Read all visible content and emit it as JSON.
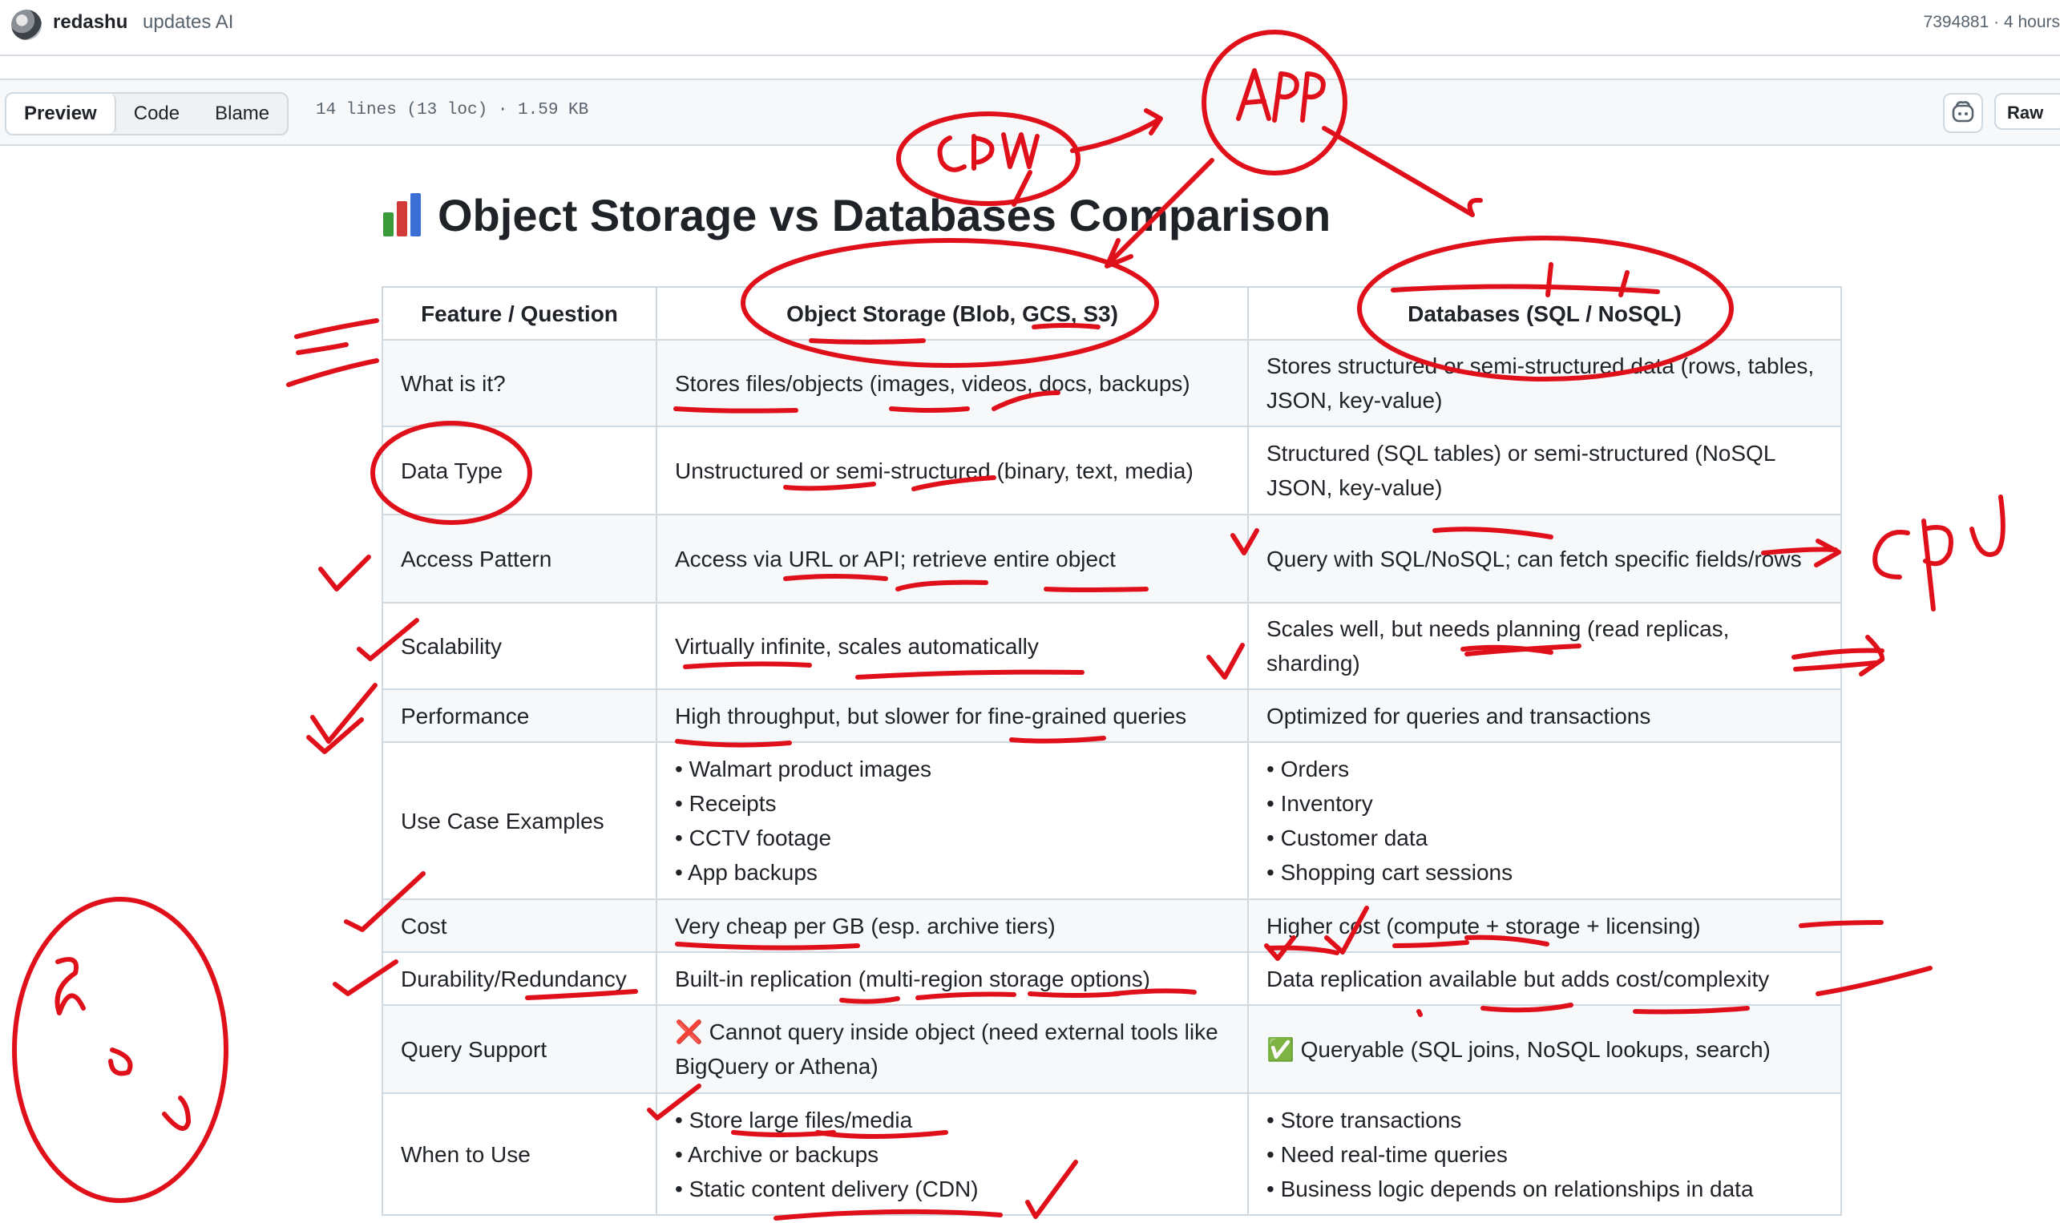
{
  "commit": {
    "author": "redashu",
    "message": "updates AI",
    "meta": "7394881 · 4 hours"
  },
  "file_header": {
    "tabs": [
      "Preview",
      "Code",
      "Blame"
    ],
    "active_tab": "Preview",
    "info": "14 lines (13 loc) · 1.59 KB",
    "raw_label": "Raw"
  },
  "document": {
    "title": "Object Storage vs Databases Comparison",
    "title_icon": "bar-chart-emoji",
    "headers": [
      "Feature / Question",
      "Object Storage (Blob, GCS, S3)",
      "Databases (SQL / NoSQL)"
    ],
    "rows": [
      {
        "feature": "What is it?",
        "object": "Stores files/objects (images, videos, docs, backups)",
        "db": "Stores structured or semi-structured data (rows, tables, JSON, key-value)"
      },
      {
        "feature": "Data Type",
        "object": "Unstructured or semi-structured (binary, text, media)",
        "db": "Structured (SQL tables) or semi-structured (NoSQL JSON, key-value)"
      },
      {
        "feature": "Access Pattern",
        "object": "Access via URL or API; retrieve entire object",
        "db": "Query with SQL/NoSQL; can fetch specific fields/rows"
      },
      {
        "feature": "Scalability",
        "object": "Virtually infinite, scales automatically",
        "db": "Scales well, but needs planning (read replicas, sharding)"
      },
      {
        "feature": "Performance",
        "object": "High throughput, but slower for fine-grained queries",
        "db": "Optimized for queries and transactions"
      },
      {
        "feature": "Use Case Examples",
        "object_list": [
          "Walmart product images",
          "Receipts",
          "CCTV footage",
          "App backups"
        ],
        "db_list": [
          "Orders",
          "Inventory",
          "Customer data",
          "Shopping cart sessions"
        ]
      },
      {
        "feature": "Cost",
        "object": "Very cheap per GB (esp. archive tiers)",
        "db": "Higher cost (compute + storage + licensing)"
      },
      {
        "feature": "Durability/Redundancy",
        "object": "Built-in replication (multi-region storage options)",
        "db": "Data replication available but adds cost/complexity"
      },
      {
        "feature": "Query Support",
        "object": "❌ Cannot query inside object (need external tools like BigQuery or Athena)",
        "db": "✅ Queryable (SQL joins, NoSQL lookups, search)"
      },
      {
        "feature": "When to Use",
        "object_list": [
          "Store large files/media",
          "Archive or backups",
          "Static content delivery (CDN)"
        ],
        "db_list": [
          "Store transactions",
          "Need real-time queries",
          "Business logic depends on relationships in data"
        ]
      }
    ]
  },
  "annotations": {
    "ink_color": "#e0101b",
    "labels": [
      "CDN",
      "App",
      "CPU"
    ]
  }
}
